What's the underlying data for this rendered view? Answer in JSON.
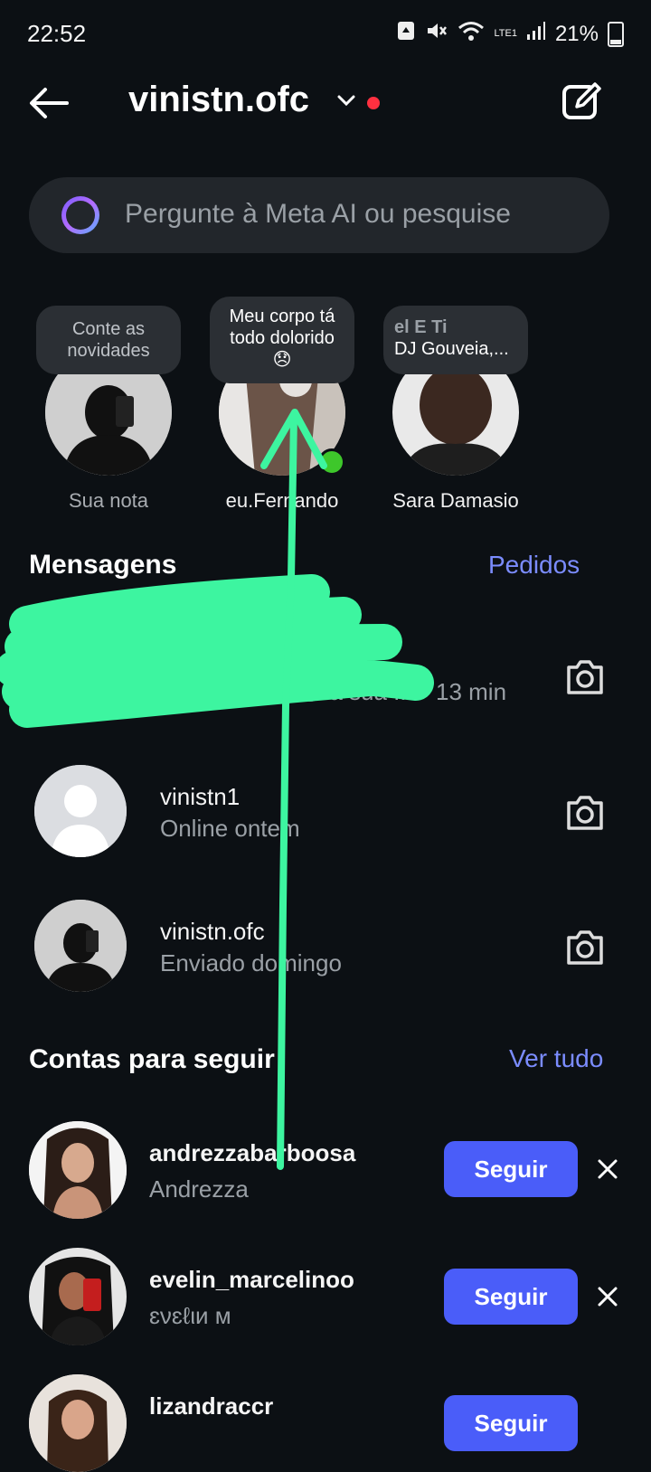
{
  "status_bar": {
    "time": "22:52",
    "network": "LTE1",
    "battery": "21%"
  },
  "header": {
    "title": "vinistn.ofc"
  },
  "search": {
    "placeholder": "Pergunte à Meta AI ou pesquise"
  },
  "notes": [
    {
      "bubble": "Conte as novidades",
      "name": "Sua nota"
    },
    {
      "bubble": "Meu corpo tá todo dolorido 😞",
      "name": "eu.Fernando"
    },
    {
      "bubble_line1": "el  E    Ti",
      "bubble_line2": "DJ Gouveia,...",
      "name": "Sara Damasio"
    }
  ],
  "messages": {
    "title": "Mensagens",
    "requests_link": "Pedidos",
    "threads": [
      {
        "preview": "😊 a sua ...",
        "time": "13 min"
      },
      {
        "name": "vinistn1",
        "status": "Online ontem"
      },
      {
        "name": "vinistn.ofc",
        "status": "Enviado domingo"
      }
    ]
  },
  "suggestions": {
    "title": "Contas para seguir",
    "see_all": "Ver tudo",
    "follow_label": "Seguir",
    "accounts": [
      {
        "username": "andrezzabarboosa",
        "name": "Andrezza"
      },
      {
        "username": "evelin_marcelinoo",
        "name": "ɛνɛℓιи м"
      },
      {
        "username": "lizandraccr",
        "name": ""
      }
    ]
  },
  "colors": {
    "background": "#0c1014",
    "accent": "#4a5df9",
    "link": "#7b8cff",
    "annotation": "#3df5a0",
    "online": "#3ec72b"
  }
}
